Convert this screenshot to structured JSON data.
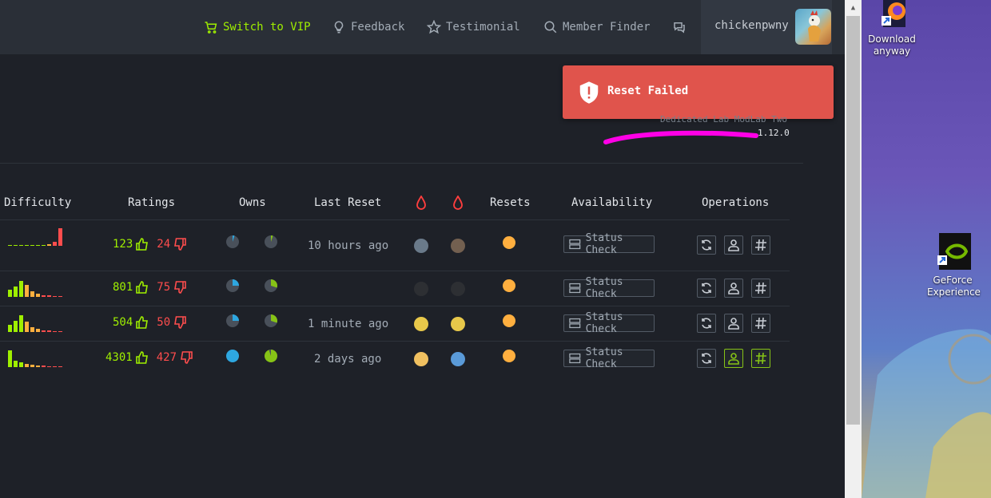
{
  "nav": {
    "vip": "Switch to VIP",
    "feedback": "Feedback",
    "testimonial": "Testimonial",
    "member_finder": "Member Finder",
    "username": "chickenpwny"
  },
  "toast": {
    "message": "Reset Failed",
    "color": "#e0544c"
  },
  "lab": {
    "name": "Dedicated Lab ModLab Two",
    "version": "1.12.0"
  },
  "table": {
    "headers": {
      "difficulty": "Difficulty",
      "ratings": "Ratings",
      "owns": "Owns",
      "last_reset": "Last Reset",
      "resets": "Resets",
      "availability": "Availability",
      "operations": "Operations"
    },
    "rows": [
      {
        "up": "123",
        "down": "24",
        "last_reset": "10 hours ago",
        "status": "Status Check",
        "own_user": 0.05,
        "own_root": 0.05
      },
      {
        "up": "801",
        "down": "75",
        "last_reset": "",
        "status": "Status Check",
        "own_user": 0.25,
        "own_root": 0.3
      },
      {
        "up": "504",
        "down": "50",
        "last_reset": "1 minute ago",
        "status": "Status Check",
        "own_user": 0.25,
        "own_root": 0.3
      },
      {
        "up": "4301",
        "down": "427",
        "last_reset": "2 days ago",
        "status": "Status Check",
        "own_user": 1.0,
        "own_root": 0.95
      }
    ]
  },
  "desktop": {
    "icons": [
      {
        "label_1": "Download",
        "label_2": "anyway"
      },
      {
        "label_1": "GeForce",
        "label_2": "Experience"
      }
    ]
  },
  "colors": {
    "accent": "#9fef00",
    "negative": "#ff4d4d",
    "reset": "#ffaf3f",
    "blood": "#ff3e3e"
  }
}
